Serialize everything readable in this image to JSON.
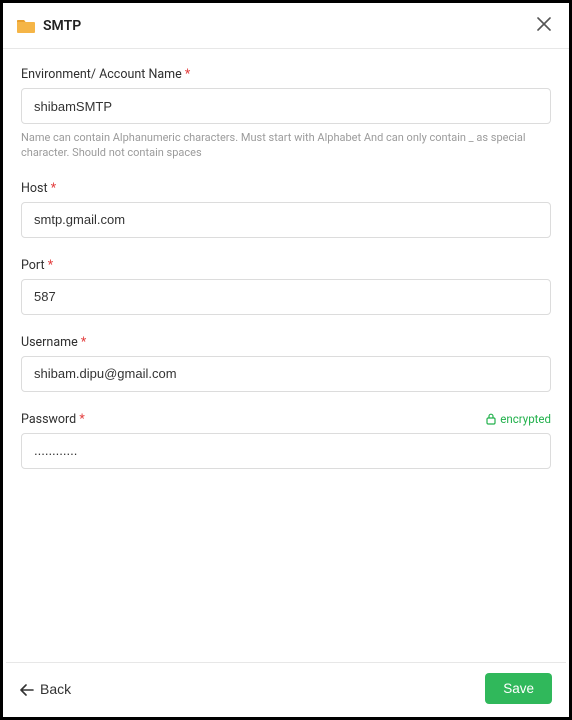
{
  "header": {
    "title": "SMTP"
  },
  "fields": {
    "env": {
      "label": "Environment/ Account Name",
      "value": "shibamSMTP",
      "helper": "Name can contain Alphanumeric characters. Must start with Alphabet And can only contain _ as special character. Should not contain spaces"
    },
    "host": {
      "label": "Host",
      "value": "smtp.gmail.com"
    },
    "port": {
      "label": "Port",
      "value": "587"
    },
    "username": {
      "label": "Username",
      "value": "shibam.dipu@gmail.com"
    },
    "password": {
      "label": "Password",
      "value": "............",
      "badge": "encrypted"
    }
  },
  "footer": {
    "back": "Back",
    "save": "Save"
  }
}
